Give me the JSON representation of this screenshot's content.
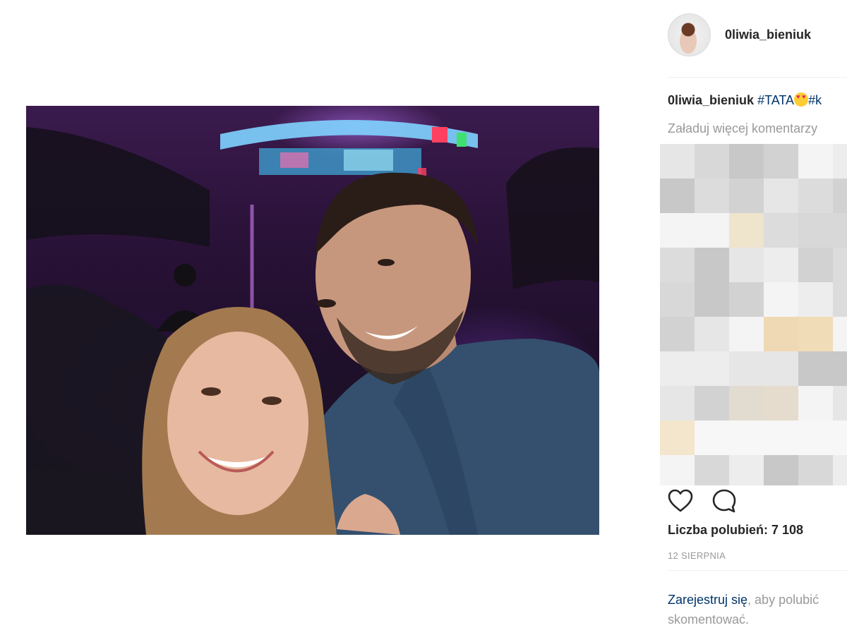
{
  "post": {
    "username": "0liwia_bieniuk",
    "caption": {
      "username": "0liwia_bieniuk",
      "tag_prefix": "#TATA",
      "tag_suffix": "#k"
    },
    "load_more_comments": "Załaduj więcej komentarzy",
    "likes_text": "Liczba polubień: 7 108",
    "date": "12 SIERPNIA",
    "signup": {
      "link": "Zarejestruj się",
      "rest_line1": ", aby polubić",
      "rest_line2": "skomentować."
    }
  },
  "icons": {
    "like": "heart-outline-icon",
    "comment": "comment-bubble-icon",
    "emoji": "heart-eyes-emoji-icon"
  },
  "colors": {
    "link": "#003569",
    "muted": "#999999",
    "text": "#262626"
  }
}
